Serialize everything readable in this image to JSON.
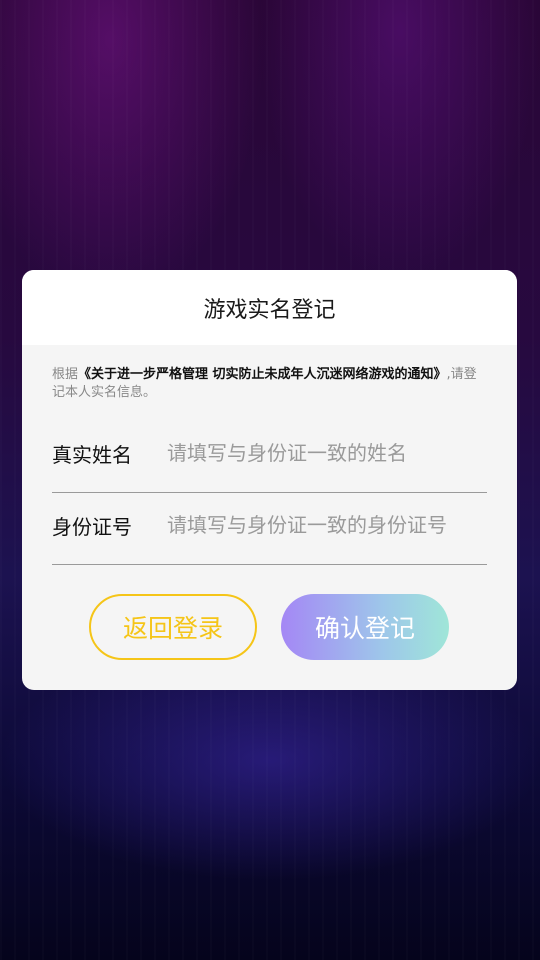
{
  "dialog": {
    "title": "游戏实名登记",
    "notice_prefix": "根据",
    "notice_policy": "《关于进一步严格管理 切实防止未成年人沉迷网络游戏的通知》",
    "notice_suffix": ",请登记本人实名信息。",
    "name_field": {
      "label": "真实姓名",
      "placeholder": "请填写与身份证一致的姓名"
    },
    "id_field": {
      "label": "身份证号",
      "placeholder": "请填写与身份证一致的身份证号"
    },
    "back_button": "返回登录",
    "confirm_button": "确认登记"
  }
}
